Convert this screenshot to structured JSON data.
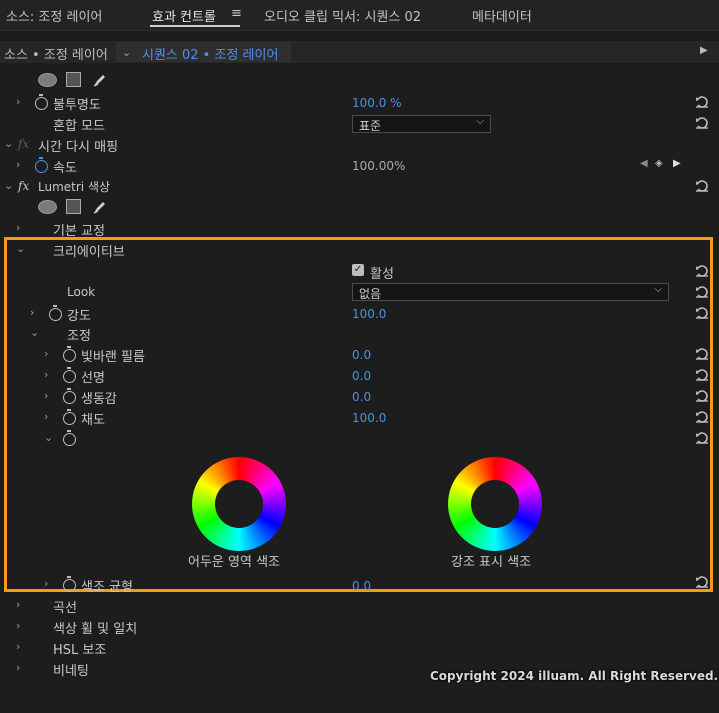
{
  "tabs": [
    {
      "label": "소스: 조정 레이어"
    },
    {
      "label": "효과 컨트롤"
    },
    {
      "label": "오디오 클립 믹서: 시퀀스 02"
    },
    {
      "label": "메타데이터"
    }
  ],
  "tab_menu_glyph": "≡",
  "source": {
    "label": "소스 • 조정 레이어",
    "sequence": "시퀀스 02 • 조정 레이어"
  },
  "opacity": {
    "label": "불투명도",
    "value": "100.0 %",
    "blend_label": "혼합 모드",
    "blend_value": "표준"
  },
  "time_remap": {
    "label": "시간 다시 매핑",
    "speed_label": "속도",
    "speed_value": "100.00%"
  },
  "lumetri": {
    "label": "Lumetri 색상",
    "basic_label": "기본 교정",
    "creative": {
      "label": "크리에이티브",
      "active_label": "활성",
      "active_checked": true,
      "look_label": "Look",
      "look_value": "없음",
      "intensity_label": "강도",
      "intensity_value": "100.0",
      "adjust_label": "조정",
      "params": [
        {
          "label": "빛바랜 필름",
          "value": "0.0"
        },
        {
          "label": "선명",
          "value": "0.0"
        },
        {
          "label": "생동감",
          "value": "0.0"
        },
        {
          "label": "채도",
          "value": "100.0"
        }
      ],
      "shadow_tint_label": "어두운 영역 색조",
      "highlight_tint_label": "강조 표시 색조",
      "tint_balance_label": "색조 균형",
      "tint_balance_value": "0.0"
    },
    "curves_label": "곡선",
    "hue_wheels_label": "색상 휠 및 일치",
    "hsl_label": "HSL 보조",
    "vignette_label": "비네팅"
  },
  "copyright": "Copyright 2024 illuam. All Right Reserved.",
  "colors": {
    "accent": "#4a90e2",
    "highlight_box": "#f39a1f",
    "background": "#1d1d1d"
  }
}
